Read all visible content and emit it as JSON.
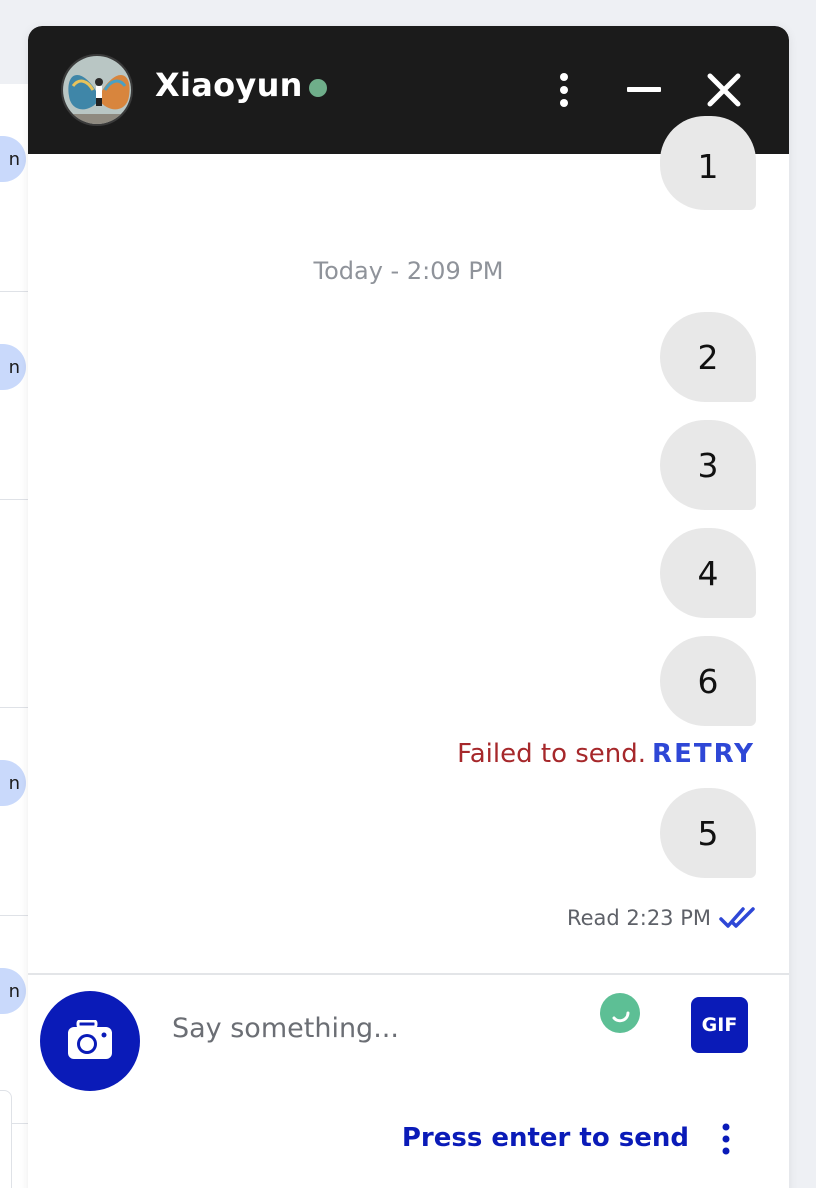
{
  "header": {
    "contact_name": "Xiaoyun",
    "online_color": "#6fae8a",
    "icons": [
      "more-options-icon",
      "minimize-icon",
      "close-icon"
    ]
  },
  "messages": [
    {
      "text": "1",
      "status": "sent"
    },
    {
      "separator": "Today - 2:09 PM"
    },
    {
      "text": "2",
      "status": "sent"
    },
    {
      "text": "3",
      "status": "sent"
    },
    {
      "text": "4",
      "status": "sent"
    },
    {
      "text": "6",
      "status": "failed"
    },
    {
      "text": "5",
      "status": "read"
    }
  ],
  "separator": "Today - 2:09 PM",
  "failed": {
    "text": "Failed to send.",
    "retry_label": "RETRY"
  },
  "read_receipt": "Read 2:23 PM",
  "composer": {
    "placeholder": "Say something...",
    "gif_label": "GIF",
    "press_enter_label": "Press enter to send"
  },
  "colors": {
    "brand": "#0a1bb8",
    "header_bg": "#1b1b1b",
    "bubble_bg": "#e8e8e8",
    "error": "#a6282b",
    "retry": "#2e47d6"
  }
}
